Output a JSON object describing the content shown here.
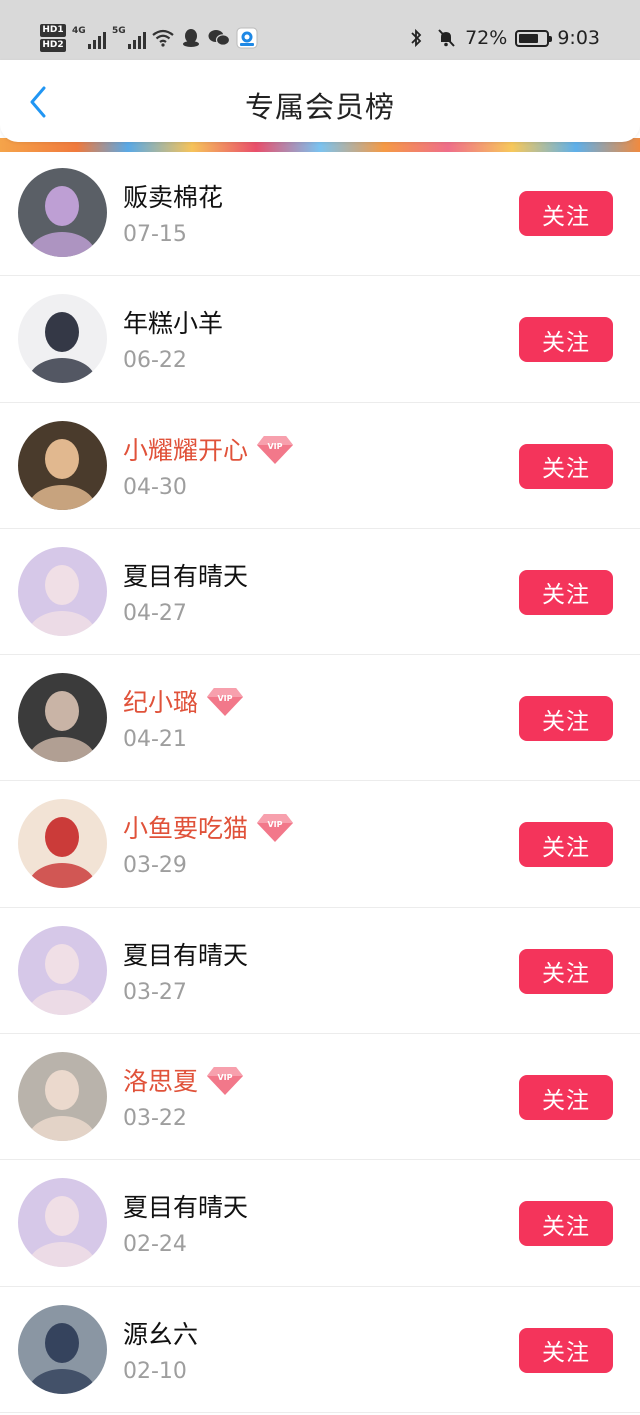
{
  "status_bar": {
    "hd1": "HD1",
    "hd2": "HD2",
    "net1": "4G",
    "net2": "5G",
    "battery": "72%",
    "time": "9:03"
  },
  "header": {
    "title": "专属会员榜"
  },
  "colors": {
    "follow_button": "#f4345b",
    "vip_name": "#e0523a",
    "back_arrow": "#2196f3"
  },
  "follow_label": "关注",
  "members": [
    {
      "name": "贩卖棉花",
      "date": "07-15",
      "vip": false,
      "avatar_bg": "#5a5f66",
      "avatar_fg": "#c9a6e0"
    },
    {
      "name": "年糕小羊",
      "date": "06-22",
      "vip": false,
      "avatar_bg": "#f0f0f2",
      "avatar_fg": "#1f2433"
    },
    {
      "name": "小耀耀开心",
      "date": "04-30",
      "vip": true,
      "avatar_bg": "#4a3b2c",
      "avatar_fg": "#f2c79a"
    },
    {
      "name": "夏目有晴天",
      "date": "04-27",
      "vip": false,
      "avatar_bg": "#d6c8e8",
      "avatar_fg": "#f3e1e6"
    },
    {
      "name": "纪小璐",
      "date": "04-21",
      "vip": true,
      "avatar_bg": "#3b3b3b",
      "avatar_fg": "#d9c2b2"
    },
    {
      "name": "小鱼要吃猫",
      "date": "03-29",
      "vip": true,
      "avatar_bg": "#f2e3d5",
      "avatar_fg": "#c62828"
    },
    {
      "name": "夏目有晴天",
      "date": "03-27",
      "vip": false,
      "avatar_bg": "#d6c8e8",
      "avatar_fg": "#f3e1e6"
    },
    {
      "name": "洛思夏",
      "date": "03-22",
      "vip": true,
      "avatar_bg": "#b9b3ab",
      "avatar_fg": "#f1ddd0"
    },
    {
      "name": "夏目有晴天",
      "date": "02-24",
      "vip": false,
      "avatar_bg": "#d6c8e8",
      "avatar_fg": "#f3e1e6"
    },
    {
      "name": "源幺六",
      "date": "02-10",
      "vip": false,
      "avatar_bg": "#8a96a3",
      "avatar_fg": "#2b3a55"
    }
  ]
}
